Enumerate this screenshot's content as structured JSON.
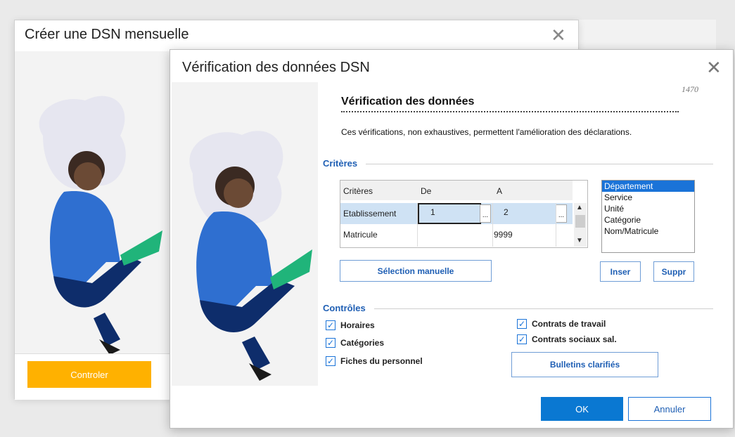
{
  "back_window": {
    "title": "Créer une DSN mensuelle",
    "close_glyph": "✕",
    "controler_label": "Controler",
    "accent_color": "#ffb100"
  },
  "dialog": {
    "title": "Vérification des données DSN",
    "close_glyph": "✕",
    "code": "1470",
    "heading": "Vérification des données",
    "description": "Ces vérifications, non exhaustives, permettent l'amélioration des déclarations.",
    "criteres_section": "Critères",
    "grid": {
      "headers": [
        "Critères",
        "De",
        "A"
      ],
      "rows": [
        {
          "critere": "Etablissement",
          "de": "1",
          "a": "2"
        },
        {
          "critere": "Matricule",
          "de": "",
          "a": "9999"
        }
      ],
      "ellipsis": "..."
    },
    "sort_list": [
      "Département",
      "Service",
      "Unité",
      "Catégorie",
      "Nom/Matricule"
    ],
    "selected_sort": "Département",
    "selection_manuelle_label": "Sélection manuelle",
    "inser_label": "Inser",
    "suppr_label": "Suppr",
    "controles_section": "Contrôles",
    "checks_left": [
      {
        "label": "Horaires",
        "checked": true
      },
      {
        "label": "Catégories",
        "checked": true
      },
      {
        "label": "Fiches du personnel",
        "checked": true
      }
    ],
    "checks_right": [
      {
        "label": "Contrats de travail",
        "checked": true
      },
      {
        "label": "Contrats sociaux sal.",
        "checked": true
      }
    ],
    "bulletins_label": "Bulletins clarifiés",
    "ok_label": "OK",
    "annuler_label": "Annuler",
    "primary_color": "#0a78d2",
    "section_color": "#1f5fb4"
  }
}
